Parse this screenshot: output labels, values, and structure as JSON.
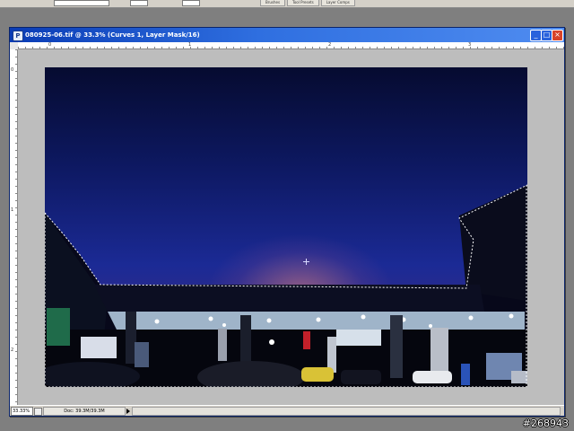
{
  "app": {
    "palette_tabs": [
      "Brushes",
      "Tool Presets",
      "Layer Comps"
    ]
  },
  "document": {
    "title": "080925-06.tif @ 33.3% (Curves 1, Layer Mask/16)",
    "ruler_h_ticks": [
      "0",
      "1",
      "2",
      "3"
    ],
    "ruler_v_ticks": [
      "0",
      "1",
      "2"
    ],
    "zoom": "33.33%",
    "doc_info": "Doc: 39.3M/39.3M"
  },
  "window_buttons": {
    "minimize": "_",
    "maximize": "□",
    "close": "×"
  },
  "icons": {
    "app_icon": "photoshop-document-icon"
  },
  "watermark": "#268943"
}
